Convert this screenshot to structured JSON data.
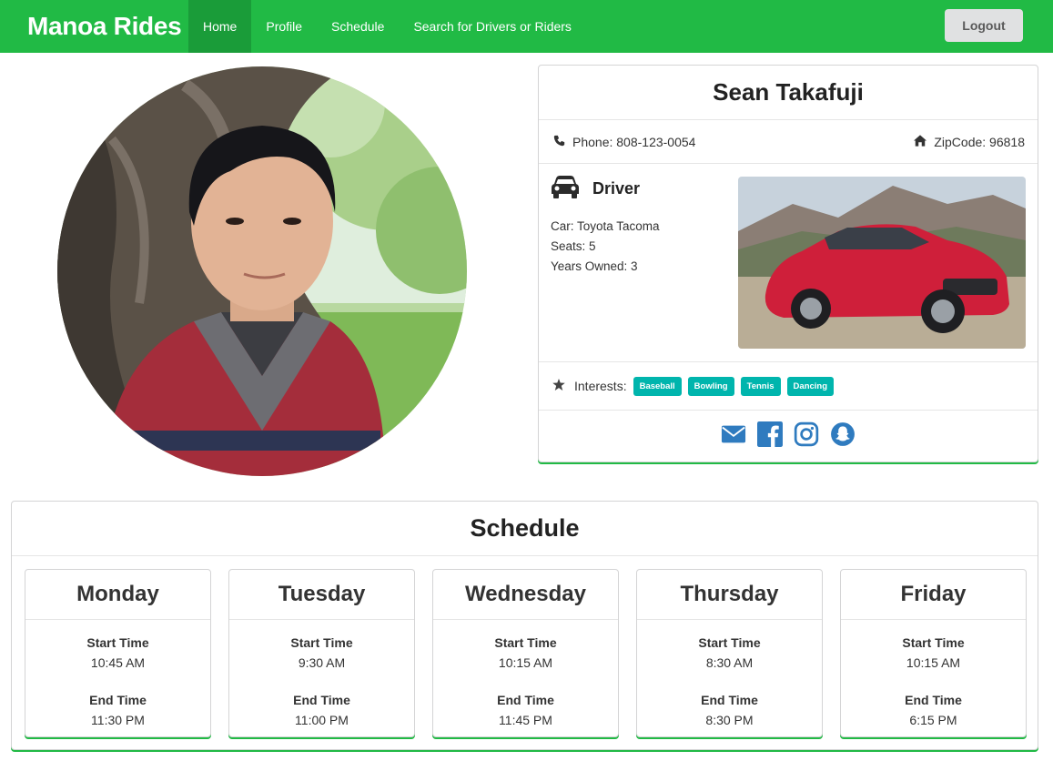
{
  "nav": {
    "brand": "Manoa Rides",
    "items": [
      {
        "label": "Home",
        "active": true
      },
      {
        "label": "Profile",
        "active": false
      },
      {
        "label": "Schedule",
        "active": false
      },
      {
        "label": "Search for Drivers or Riders",
        "active": false
      }
    ],
    "logout": "Logout"
  },
  "profile": {
    "name": "Sean Takafuji",
    "phone": "Phone: 808-123-0054",
    "zipcode": "ZipCode: 96818",
    "role": "Driver",
    "car": "Car: Toyota Tacoma",
    "seats": "Seats: 5",
    "years_owned": "Years Owned: 3",
    "interests_label": "Interests:",
    "interests": [
      "Baseball",
      "Bowling",
      "Tennis",
      "Dancing"
    ],
    "social": [
      "envelope-icon",
      "facebook-icon",
      "instagram-icon",
      "snapchat-icon"
    ]
  },
  "schedule": {
    "title": "Schedule",
    "start_label": "Start Time",
    "end_label": "End Time",
    "days": [
      {
        "day": "Monday",
        "start": "10:45 AM",
        "end": "11:30 PM"
      },
      {
        "day": "Tuesday",
        "start": "9:30 AM",
        "end": "11:00 PM"
      },
      {
        "day": "Wednesday",
        "start": "10:15 AM",
        "end": "11:45 PM"
      },
      {
        "day": "Thursday",
        "start": "8:30 AM",
        "end": "8:30 PM"
      },
      {
        "day": "Friday",
        "start": "10:15 AM",
        "end": "6:15 PM"
      }
    ]
  },
  "colors": {
    "brand_green": "#21ba45",
    "active_nav": "#1a9c39",
    "teal_tag": "#00b5ad",
    "social_blue": "#2f7bbf"
  }
}
